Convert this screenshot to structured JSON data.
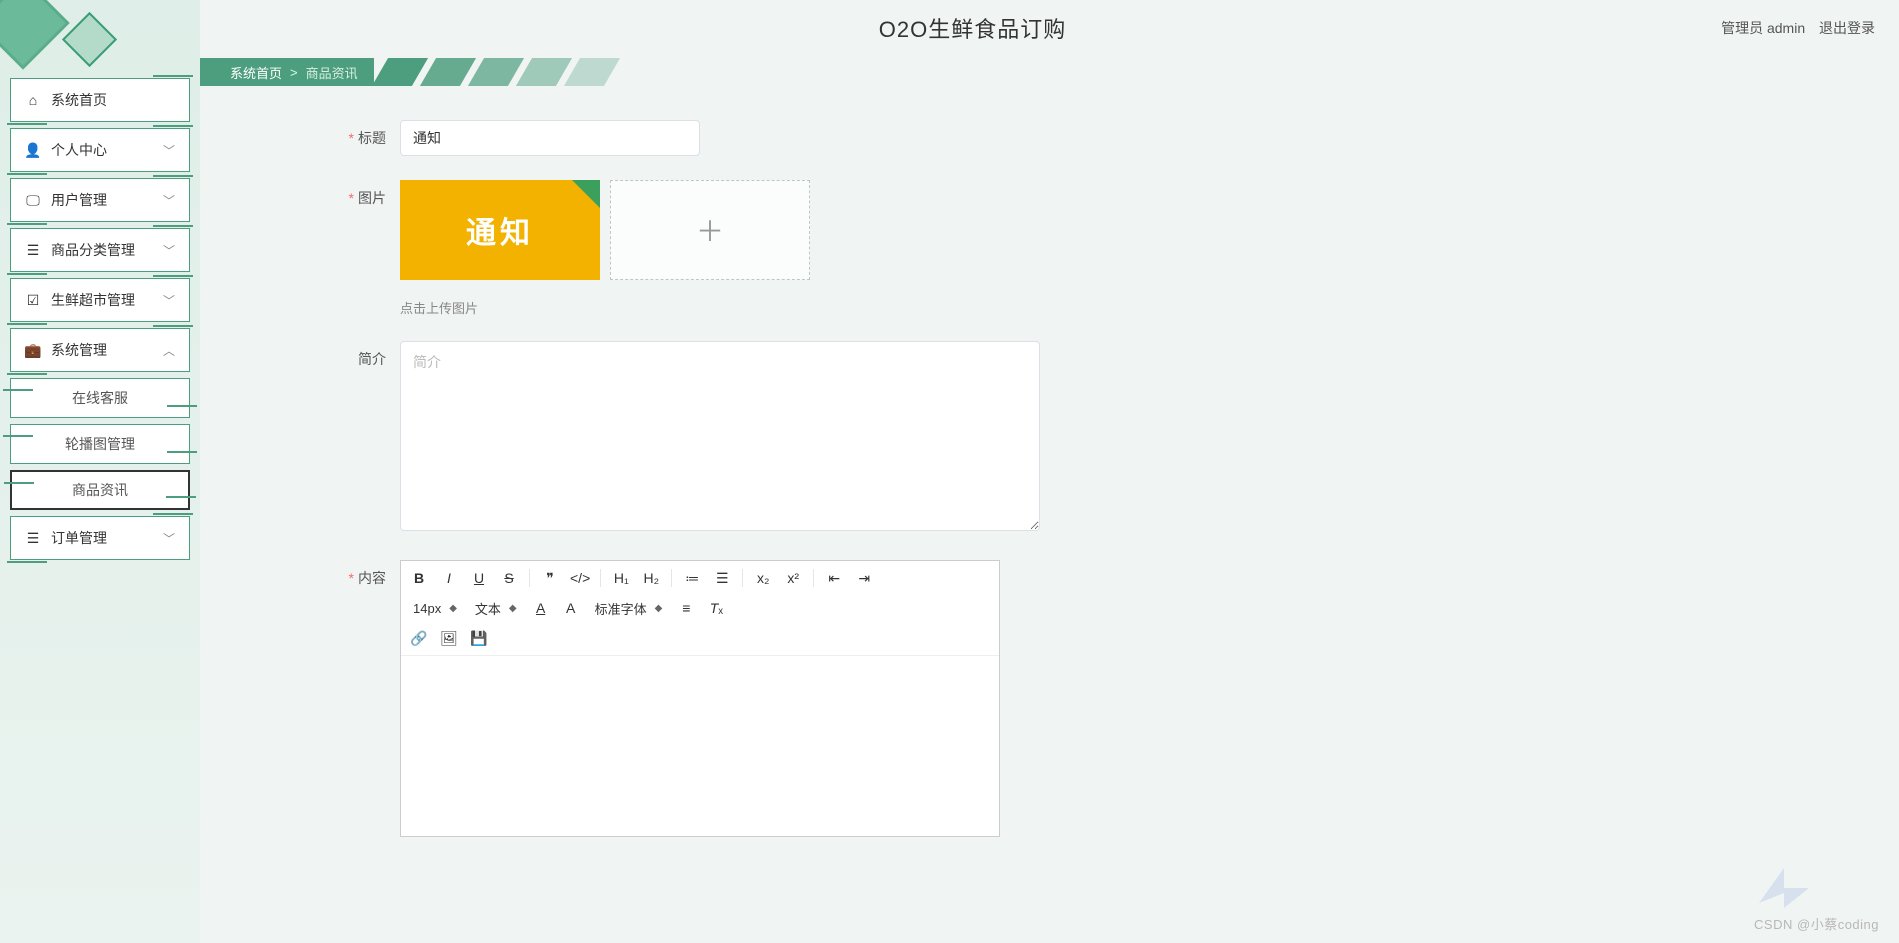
{
  "header": {
    "title": "O2O生鲜食品订购",
    "role_label": "管理员",
    "username": "admin",
    "logout": "退出登录"
  },
  "sidebar": {
    "items": [
      {
        "icon": "home",
        "label": "系统首页",
        "expandable": false
      },
      {
        "icon": "user",
        "label": "个人中心",
        "expandable": true
      },
      {
        "icon": "monitor",
        "label": "用户管理",
        "expandable": true
      },
      {
        "icon": "list",
        "label": "商品分类管理",
        "expandable": true
      },
      {
        "icon": "check",
        "label": "生鲜超市管理",
        "expandable": true
      },
      {
        "icon": "briefcase",
        "label": "系统管理",
        "expandable": true,
        "expanded": true
      },
      {
        "icon": "list",
        "label": "订单管理",
        "expandable": true
      }
    ],
    "sub_items": [
      {
        "label": "在线客服",
        "active": false
      },
      {
        "label": "轮播图管理",
        "active": false
      },
      {
        "label": "商品资讯",
        "active": true
      }
    ]
  },
  "breadcrumb": {
    "home": "系统首页",
    "sep": ">",
    "current": "商品资讯"
  },
  "form": {
    "title_label": "标题",
    "title_value": "通知",
    "image_label": "图片",
    "image_thumb_text": "通知",
    "upload_hint": "点击上传图片",
    "intro_label": "简介",
    "intro_placeholder": "简介",
    "content_label": "内容"
  },
  "editor": {
    "font_size": "14px",
    "format": "文本",
    "font_family": "标准字体"
  },
  "watermark": "CSDN @小蔡coding"
}
